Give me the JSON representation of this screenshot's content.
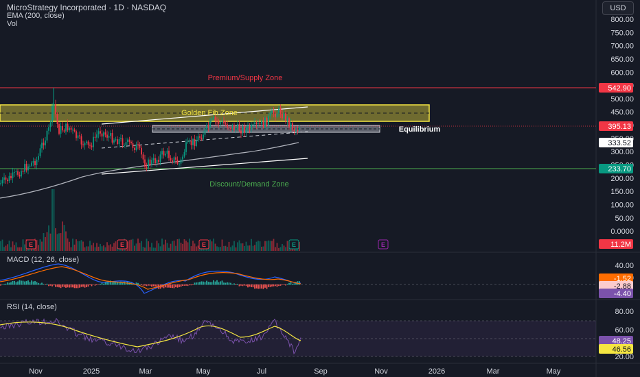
{
  "header": {
    "symbol_line": "MicroStrategy Incorporated · 1D · NASDAQ",
    "ema_line": "EMA (200, close)",
    "vol_line": "Vol",
    "currency": "USD"
  },
  "price_axis": {
    "ticks": [
      "800.00",
      "750.00",
      "700.00",
      "650.00",
      "600.00",
      "550.00",
      "500.00",
      "450.00",
      "400.00",
      "350.00",
      "300.00",
      "250.00",
      "200.00",
      "150.00",
      "100.00",
      "50.00",
      "0.0000"
    ],
    "badges": [
      {
        "label": "542.90",
        "bg": "#f23645",
        "fg": "#ffffff"
      },
      {
        "label": "395.13",
        "bg": "#f23645",
        "fg": "#ffffff"
      },
      {
        "label": "333.52",
        "bg": "#ffffff",
        "fg": "#131722"
      },
      {
        "label": "233.70",
        "bg": "#089981",
        "fg": "#ffffff"
      },
      {
        "label": "11.2M",
        "bg": "#f23645",
        "fg": "#ffffff"
      }
    ]
  },
  "annotations": {
    "premium": "Premium/Supply Zone",
    "golden": "Golden Fib Zone",
    "equilibrium": "Equilibrium",
    "discount": "Discount/Demand Zone"
  },
  "earnings_marker": "E",
  "macd": {
    "title": "MACD (12, 26, close)",
    "ticks": [
      "40.00",
      "20.00"
    ],
    "badges": [
      {
        "label": "-1.52",
        "bg": "#ff6d00",
        "fg": "#ffffff"
      },
      {
        "label": "-2.88",
        "bg": "#fccbcd",
        "fg": "#131722"
      },
      {
        "label": "-4.40",
        "bg": "#7b52ab",
        "fg": "#ffffff"
      }
    ]
  },
  "rsi": {
    "title": "RSI (14, close)",
    "ticks": [
      "80.00",
      "60.00",
      "20.00"
    ],
    "badges": [
      {
        "label": "48.25",
        "bg": "#7b52ab",
        "fg": "#ffffff"
      },
      {
        "label": "46.56",
        "bg": "#f5e642",
        "fg": "#131722"
      }
    ]
  },
  "time_axis": [
    "Nov",
    "2025",
    "Mar",
    "May",
    "Jul",
    "Sep",
    "Nov",
    "2026",
    "Mar",
    "May"
  ],
  "colors": {
    "up": "#089981",
    "down": "#f23645",
    "premium_line": "#f23645",
    "demand_line": "#4caf50",
    "golden_zone_fill": "#f5e64266",
    "golden_zone_border": "#f5e642",
    "equilibrium_fill": "#787b86",
    "ema": "#b2b5be",
    "macd_line": "#2962ff",
    "signal_line": "#ff6d00",
    "rsi_line": "#7b52ab",
    "rsi_ma": "#f5e642"
  }
}
